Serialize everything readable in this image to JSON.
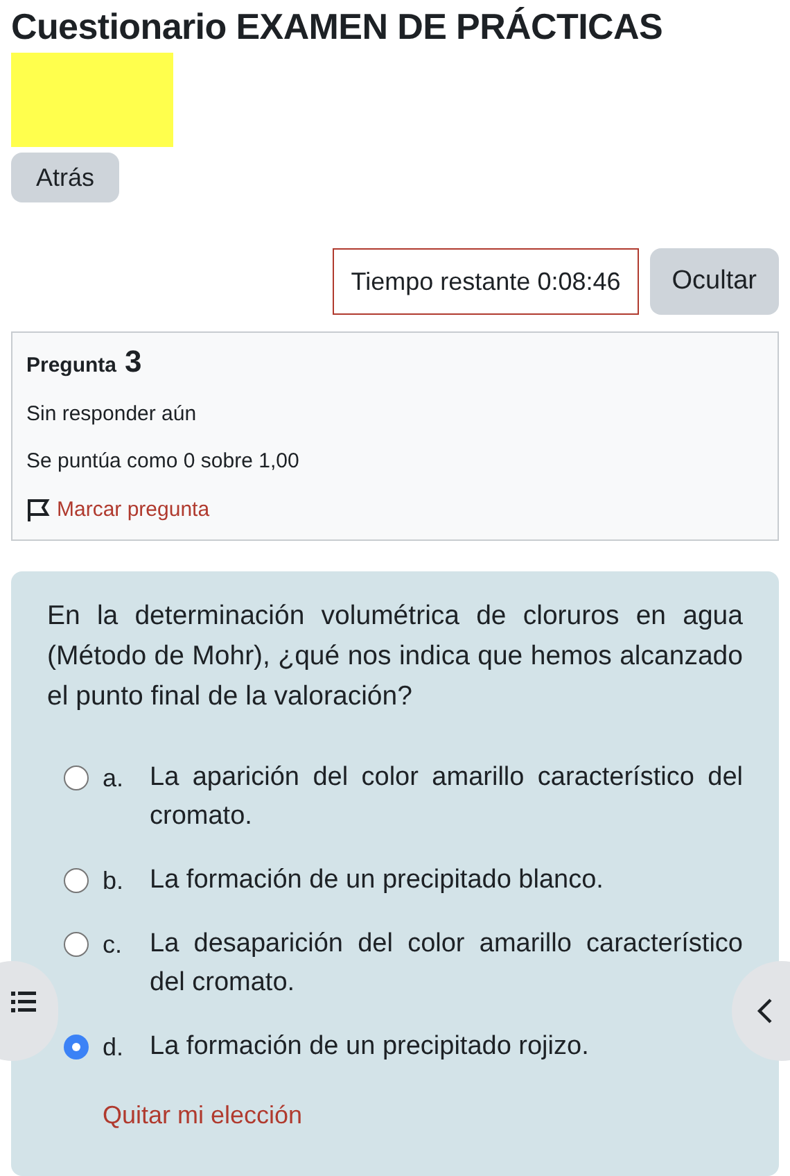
{
  "title": "Cuestionario EXAMEN DE PRÁCTICAS",
  "back_button": "Atrás",
  "timer": {
    "label": "Tiempo restante 0:08:46",
    "hide_button": "Ocultar"
  },
  "question_info": {
    "label": "Pregunta",
    "number": "3",
    "status": "Sin responder aún",
    "grade": "Se puntúa como 0 sobre 1,00",
    "flag_link": "Marcar pregunta"
  },
  "question": {
    "text": "En la determinación volumétrica de cloruros en agua (Método de Mohr), ¿qué nos indica que hemos alcanzado el punto final de la valoración?",
    "options": [
      {
        "letter": "a.",
        "text": "La aparición del color amarillo característico del cromato.",
        "selected": false
      },
      {
        "letter": "b.",
        "text": "La formación de un precipitado blanco.",
        "selected": false
      },
      {
        "letter": "c.",
        "text": "La desaparición del color amarillo característico del cromato.",
        "selected": false
      },
      {
        "letter": "d.",
        "text": "La formación de un precipitado rojizo.",
        "selected": true
      }
    ],
    "clear_link": "Quitar mi elección"
  }
}
